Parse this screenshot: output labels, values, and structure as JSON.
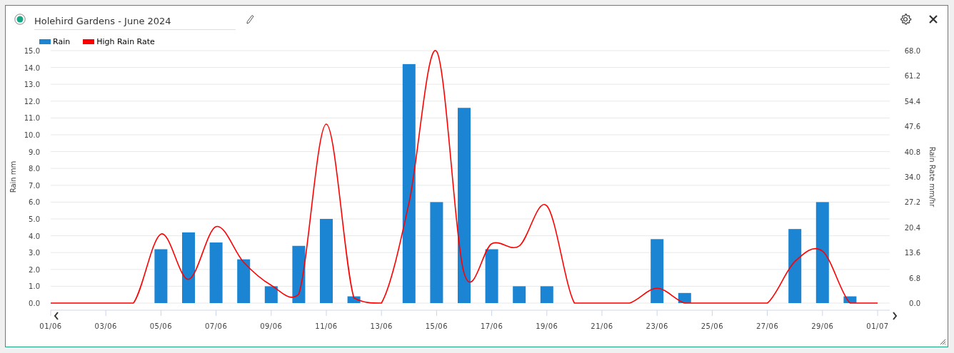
{
  "widget": {
    "title": "Holehird Gardens - June 2024",
    "status_on": true
  },
  "chart": {
    "chart_data": {
      "type": "bar",
      "ylabel": "Rain mm",
      "y2label": "Rain Rate mm/hr",
      "categories": [
        "01/06",
        null,
        "03/06",
        null,
        "05/06",
        null,
        "07/06",
        null,
        "09/06",
        null,
        "11/06",
        null,
        "13/06",
        null,
        "15/06",
        null,
        "17/06",
        null,
        "19/06",
        null,
        "21/06",
        null,
        "23/06",
        null,
        "25/06",
        null,
        "27/06",
        null,
        "29/06",
        null,
        "01/07"
      ],
      "series": [
        {
          "name": "Rain",
          "color": "#1b84d3",
          "values": [
            0,
            0,
            0,
            0,
            3.2,
            4.2,
            3.6,
            2.6,
            1.0,
            3.4,
            5.0,
            0.4,
            0,
            14.2,
            6.0,
            11.6,
            3.2,
            1.0,
            1.0,
            0,
            0,
            0,
            3.8,
            0.6,
            0,
            0,
            0,
            4.4,
            6.0,
            0.4,
            null
          ]
        },
        {
          "name": "High Rain Rate",
          "type": "line",
          "axis": "y2",
          "color": "#ff0000",
          "values": [
            0,
            0,
            0,
            0,
            18.6,
            6.4,
            20.6,
            11,
            4.8,
            2.4,
            48.2,
            1.4,
            0,
            27,
            67.8,
            8,
            16,
            15.4,
            26.2,
            0,
            0,
            0,
            4,
            0,
            0,
            0,
            0,
            11.2,
            14,
            0,
            0
          ]
        }
      ],
      "ylim": [
        0,
        15
      ],
      "y2lim": [
        0,
        68
      ],
      "grid": true,
      "yticks": [
        {
          "value": 0,
          "label": "0.0"
        },
        {
          "value": 1,
          "label": "1.0"
        },
        {
          "value": 2,
          "label": "2.0"
        },
        {
          "value": 3,
          "label": "3.0"
        },
        {
          "value": 4,
          "label": "4.0"
        },
        {
          "value": 5,
          "label": "5.0"
        },
        {
          "value": 6,
          "label": "6.0"
        },
        {
          "value": 7,
          "label": "7.0"
        },
        {
          "value": 8,
          "label": "8.0"
        },
        {
          "value": 9,
          "label": "9.0"
        },
        {
          "value": 10,
          "label": "10.0"
        },
        {
          "value": 11,
          "label": "11.0"
        },
        {
          "value": 12,
          "label": "12.0"
        },
        {
          "value": 13,
          "label": "13.0"
        },
        {
          "value": 14,
          "label": "14.0"
        },
        {
          "value": 15,
          "label": "15.0"
        }
      ],
      "y2ticks": [
        {
          "value": 0,
          "label": "0.0"
        },
        {
          "value": 6.8,
          "label": "6.8"
        },
        {
          "value": 13.6,
          "label": "13.6"
        },
        {
          "value": 20.4,
          "label": "20.4"
        },
        {
          "value": 27.2,
          "label": "27.2"
        },
        {
          "value": 34,
          "label": "34.0"
        },
        {
          "value": 40.8,
          "label": "40.8"
        },
        {
          "value": 47.6,
          "label": "47.6"
        },
        {
          "value": 54.4,
          "label": "54.4"
        },
        {
          "value": 61.2,
          "label": "61.2"
        },
        {
          "value": 68,
          "label": "68.0"
        }
      ]
    }
  }
}
